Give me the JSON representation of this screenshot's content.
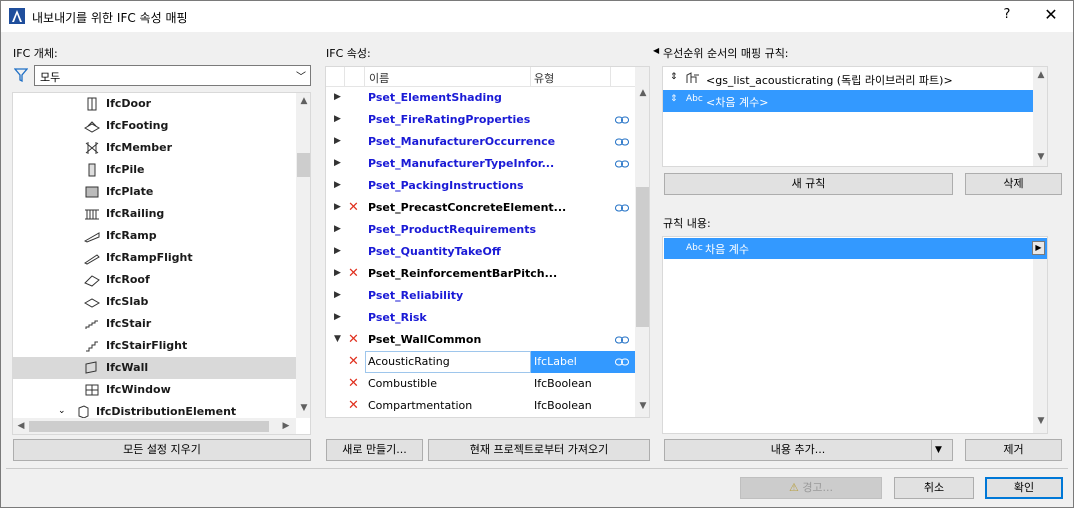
{
  "window": {
    "title": "내보내기를 위한 IFC 속성 매핑",
    "help": "?",
    "close": "✕"
  },
  "left": {
    "label": "IFC 개체:",
    "filter_value": "모두",
    "tree_items": [
      {
        "label": "IfcDoor",
        "icon": "door-icon"
      },
      {
        "label": "IfcFooting",
        "icon": "footing-icon"
      },
      {
        "label": "IfcMember",
        "icon": "member-icon"
      },
      {
        "label": "IfcPile",
        "icon": "pile-icon"
      },
      {
        "label": "IfcPlate",
        "icon": "plate-icon"
      },
      {
        "label": "IfcRailing",
        "icon": "railing-icon"
      },
      {
        "label": "IfcRamp",
        "icon": "ramp-icon"
      },
      {
        "label": "IfcRampFlight",
        "icon": "ramp-flight-icon"
      },
      {
        "label": "IfcRoof",
        "icon": "roof-icon"
      },
      {
        "label": "IfcSlab",
        "icon": "slab-icon"
      },
      {
        "label": "IfcStair",
        "icon": "stair-icon"
      },
      {
        "label": "IfcStairFlight",
        "icon": "stair-flight-icon"
      },
      {
        "label": "IfcWall",
        "icon": "wall-icon"
      },
      {
        "label": "IfcWindow",
        "icon": "window-icon"
      },
      {
        "label": "IfcDistributionElement",
        "icon": "distribution-element-icon"
      }
    ],
    "clear_button": "모든 설정 지우기"
  },
  "middle": {
    "label": "IFC 속성:",
    "columns": {
      "name": "이름",
      "type": "유형"
    },
    "rows": [
      {
        "name": "Pset_ElementShading",
        "color": "blue",
        "x": false,
        "link": false,
        "expand": "▶"
      },
      {
        "name": "Pset_FireRatingProperties",
        "color": "blue",
        "x": false,
        "link": true,
        "expand": "▶"
      },
      {
        "name": "Pset_ManufacturerOccurrence",
        "color": "blue",
        "x": false,
        "link": true,
        "expand": "▶"
      },
      {
        "name": "Pset_ManufacturerTypeInfor...",
        "color": "blue",
        "x": false,
        "link": true,
        "expand": "▶"
      },
      {
        "name": "Pset_PackingInstructions",
        "color": "blue",
        "x": false,
        "link": false,
        "expand": "▶"
      },
      {
        "name": "Pset_PrecastConcreteElement...",
        "color": "black",
        "x": true,
        "link": true,
        "expand": "▶"
      },
      {
        "name": "Pset_ProductRequirements",
        "color": "blue",
        "x": false,
        "link": false,
        "expand": "▶"
      },
      {
        "name": "Pset_QuantityTakeOff",
        "color": "blue",
        "x": false,
        "link": false,
        "expand": "▶"
      },
      {
        "name": "Pset_ReinforcementBarPitch...",
        "color": "black",
        "x": true,
        "link": false,
        "expand": "▶"
      },
      {
        "name": "Pset_Reliability",
        "color": "blue",
        "x": false,
        "link": false,
        "expand": "▶"
      },
      {
        "name": "Pset_Risk",
        "color": "blue",
        "x": false,
        "link": false,
        "expand": "▶"
      },
      {
        "name": "Pset_WallCommon",
        "color": "black",
        "x": true,
        "link": true,
        "expand": "▼"
      },
      {
        "name": "AcousticRating",
        "color": "plain",
        "x": true,
        "link": true,
        "expand": "",
        "type": "IfcLabel",
        "selected": true
      },
      {
        "name": "Combustible",
        "color": "plain",
        "x": true,
        "link": false,
        "expand": "",
        "type": "IfcBoolean"
      },
      {
        "name": "Compartmentation",
        "color": "plain",
        "x": true,
        "link": false,
        "expand": "",
        "type": "IfcBoolean"
      }
    ],
    "new_button": "새로 만들기...",
    "import_button": "현재 프로젝트로부터 가져오기"
  },
  "right": {
    "rules_label": "우선순위 순서의 매핑 규칙:",
    "rules": [
      {
        "icon": "library-part-icon",
        "text": "<gs_list_acousticrating (독립 라이브러리 파트)>",
        "selected": false
      },
      {
        "icon": "Abc",
        "text": "<차음 계수>",
        "selected": true
      }
    ],
    "new_rule_button": "새 규칙",
    "delete_button": "삭제",
    "content_label": "규칙 내용:",
    "content_row": {
      "icon": "Abc",
      "text": "차음 계수"
    },
    "add_content_button": "내용 추가...",
    "remove_button": "제거"
  },
  "footer": {
    "warning_button": "경고...",
    "cancel_button": "취소",
    "ok_button": "확인"
  },
  "colors": {
    "selection": "#3399ff",
    "blue_text": "#1a1ad6",
    "x_red": "#e0301e"
  }
}
